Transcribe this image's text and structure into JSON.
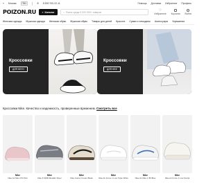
{
  "topbar": {
    "city": "Москва",
    "city_tag": "ПВЗ",
    "phone": "8 800 700-22-11",
    "links": [
      "Помощь",
      "Доставка",
      "Избранное",
      "Профиль"
    ]
  },
  "header": {
    "logo": "POIZON.RU",
    "catalog_label": "Каталог",
    "search_placeholder": "Поиск среди 5 000 000+ товаров",
    "icons": [
      {
        "label": "Избранное",
        "icon": "heart-icon"
      },
      {
        "label": "Корзина",
        "icon": "cart-icon"
      },
      {
        "label": "Войти",
        "icon": "user-icon"
      }
    ]
  },
  "categories": [
    "Женская одежда",
    "Мужская одежда",
    "Женская обувь",
    "Мужская обувь",
    "Товары для детей",
    "Красота",
    "Сумки и чемоданы",
    "Аксессуары",
    "Украшения"
  ],
  "banners": [
    {
      "title": "Кроссовки",
      "button": "ДЛЯ НЕГО"
    },
    {
      "title": "Кроссовки",
      "button": "ДЛЯ НЕЕ"
    }
  ],
  "promo": {
    "text": "Кроссовки Nike. Качество и надежность, проверенные временем.",
    "link": "Смотреть все"
  },
  "products": [
    {
      "brand": "Nike",
      "name": "Nike Air Max 270 Pink",
      "color": "#e8c6c9"
    },
    {
      "brand": "Nike",
      "name": "Nike P-6000 Metallic Silver",
      "color": "#7a7d84"
    },
    {
      "brand": "Nike",
      "name": "Nike Cortez Cream Black",
      "color": "#c9bfae"
    },
    {
      "brand": "Nike",
      "name": "Nike Air Force 1 Low Triple White",
      "color": "#f3f3f3"
    },
    {
      "brand": "Nike",
      "name": "Nike Air Max 1 '86 Blue",
      "color": "#e6e6e6"
    },
    {
      "brand": "Nike",
      "name": "Nike Air Force 1 Low Sculpt",
      "color": "#f1efe9"
    }
  ]
}
